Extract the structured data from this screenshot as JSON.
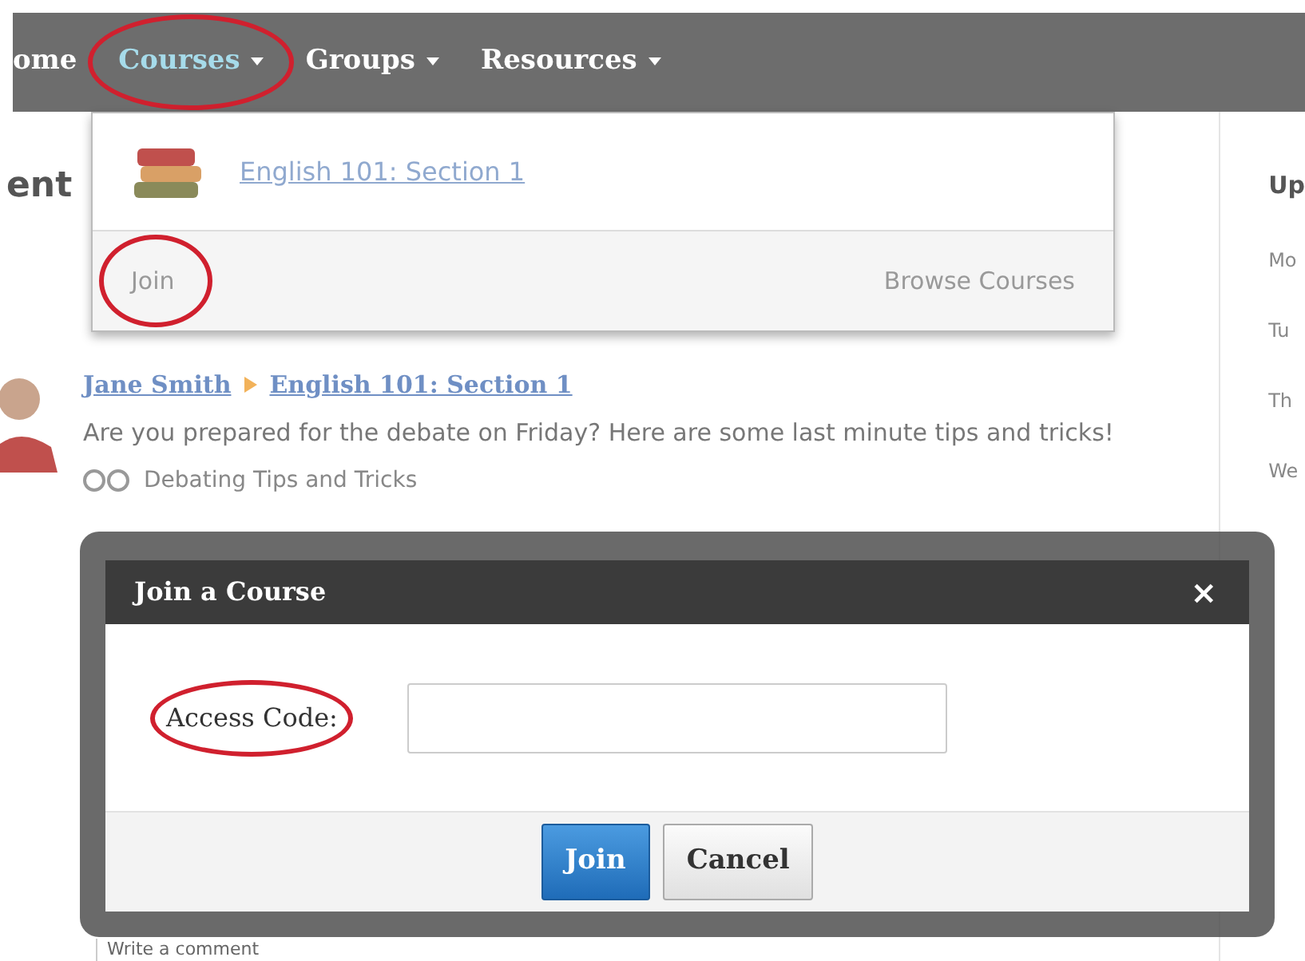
{
  "nav": {
    "items": [
      {
        "label": "ome",
        "caret": false,
        "selected": false,
        "circled": false
      },
      {
        "label": "Courses",
        "caret": true,
        "selected": true,
        "circled": true
      },
      {
        "label": "Groups",
        "caret": true,
        "selected": false,
        "circled": false
      },
      {
        "label": "Resources",
        "caret": true,
        "selected": false,
        "circled": false
      }
    ]
  },
  "courses_menu": {
    "courses": [
      "English 101: Section 1"
    ],
    "join": {
      "label": "Join",
      "circled": true
    },
    "browse": "Browse Courses"
  },
  "feed": {
    "title": "ent",
    "post": {
      "author": "Jane Smith",
      "course": "English 101: Section 1",
      "message": "Are you prepared for the debate on Friday? Here are some last minute tips and tricks!",
      "attachment": "Debating Tips and Tricks"
    },
    "comment_placeholder": "Write a comment"
  },
  "sidebar": {
    "title": "Up",
    "labels": [
      "Mo",
      "Tu",
      "Th",
      "We"
    ]
  },
  "modal": {
    "title": "Join a Course",
    "close": "×",
    "field_label": {
      "text": "Access Code:",
      "circled": true
    },
    "buttons": [
      {
        "label": "Join",
        "kind": "primary"
      },
      {
        "label": "Cancel",
        "kind": "secondary"
      }
    ]
  }
}
